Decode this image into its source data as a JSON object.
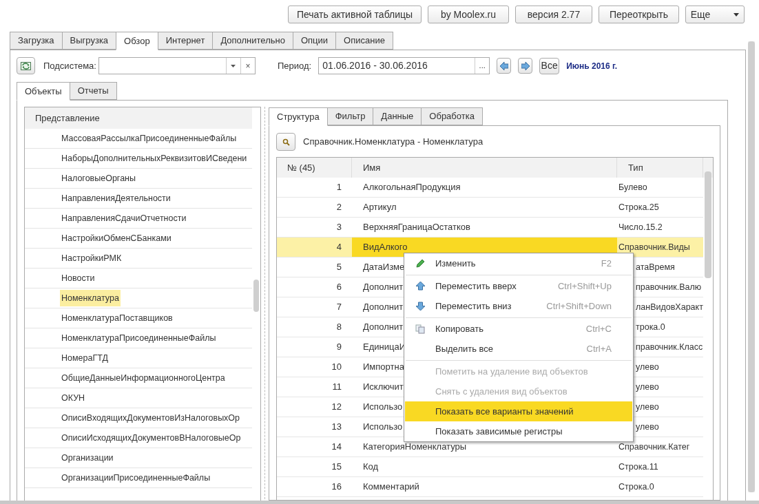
{
  "top_buttons": [
    {
      "label": "Печать активной таблицы",
      "kind": "plain"
    },
    {
      "label": "by Moolex.ru",
      "kind": "plain"
    },
    {
      "label": "версия 2.77",
      "kind": "plain"
    },
    {
      "label": "Переоткрыть",
      "kind": "plain"
    },
    {
      "label": "Еще",
      "kind": "dropdown"
    }
  ],
  "main_tabs": [
    {
      "label": "Загрузка",
      "selected": false
    },
    {
      "label": "Выгрузка",
      "selected": false
    },
    {
      "label": "Обзор",
      "selected": true
    },
    {
      "label": "Интернет",
      "selected": false
    },
    {
      "label": "Дополнительно",
      "selected": false
    },
    {
      "label": "Опции",
      "selected": false
    },
    {
      "label": "Описание",
      "selected": false
    }
  ],
  "filter_bar": {
    "subsystem_label": "Подсистема:",
    "period_label": "Период:",
    "period_value": "01.06.2016 - 30.06.2016",
    "ellipsis_button": "...",
    "clear_button": "×",
    "all_button": "Все",
    "period_title": "Июнь 2016 г."
  },
  "sub_tabs": [
    {
      "label": "Объекты",
      "selected": true
    },
    {
      "label": "Отчеты",
      "selected": false
    }
  ],
  "object_list": {
    "header": "Представление",
    "items": [
      {
        "label": "МассоваяРассылкаПрисоединенныеФайлы",
        "selected": false
      },
      {
        "label": "НаборыДополнительныхРеквизитовИСведени",
        "selected": false
      },
      {
        "label": "НалоговыеОрганы",
        "selected": false
      },
      {
        "label": "НаправленияДеятельности",
        "selected": false
      },
      {
        "label": "НаправленияСдачиОтчетности",
        "selected": false
      },
      {
        "label": "НастройкиОбменСБанками",
        "selected": false
      },
      {
        "label": "НастройкиРМК",
        "selected": false
      },
      {
        "label": "Новости",
        "selected": false
      },
      {
        "label": "Номенклатура",
        "selected": true
      },
      {
        "label": "НоменклатураПоставщиков",
        "selected": false
      },
      {
        "label": "НоменклатураПрисоединенныеФайлы",
        "selected": false
      },
      {
        "label": "НомераГТД",
        "selected": false
      },
      {
        "label": "ОбщиеДанныеИнформационногоЦентра",
        "selected": false
      },
      {
        "label": "ОКУН",
        "selected": false
      },
      {
        "label": "ОписиВходящихДокументовИзНалоговыхОр",
        "selected": false
      },
      {
        "label": "ОписиИсходящихДокументовВНалоговыеОр",
        "selected": false
      },
      {
        "label": "Организации",
        "selected": false
      },
      {
        "label": "ОрганизацииПрисоединенныеФайлы",
        "selected": false
      }
    ]
  },
  "detail_tabs": [
    {
      "label": "Структура",
      "selected": true
    },
    {
      "label": "Фильтр",
      "selected": false
    },
    {
      "label": "Данные",
      "selected": false
    },
    {
      "label": "Обработка",
      "selected": false
    }
  ],
  "object_title": "Справочник.Номенклатура - Номенклатура",
  "table": {
    "columns": [
      "№ (45)",
      "Имя",
      "Тип"
    ],
    "rows": [
      {
        "num": "1",
        "name": "АлкогольнаяПродукция",
        "type": "Булево",
        "selected": false
      },
      {
        "num": "2",
        "name": "Артикул",
        "type": "Строка.25",
        "selected": false
      },
      {
        "num": "3",
        "name": "ВерхняяГраницаОстатков",
        "type": "Число.15.2",
        "selected": false
      },
      {
        "num": "4",
        "name": "ВидАлкого",
        "type": "Справочник.Виды",
        "selected": true
      },
      {
        "num": "5",
        "name": "ДатаИзме",
        "type": "атаВремя",
        "selected": false
      },
      {
        "num": "6",
        "name": "Дополнит",
        "type": "правочник.Валю",
        "selected": false
      },
      {
        "num": "7",
        "name": "Дополнит",
        "type": "ланВидовХаракт",
        "selected": false
      },
      {
        "num": "8",
        "name": "Дополнит",
        "type": "трока.0",
        "selected": false
      },
      {
        "num": "9",
        "name": "ЕдиницаИ",
        "type": "правочник.Класс",
        "selected": false
      },
      {
        "num": "10",
        "name": "Импортна",
        "type": "улево",
        "selected": false
      },
      {
        "num": "11",
        "name": "Исключит",
        "type": "улево",
        "selected": false
      },
      {
        "num": "12",
        "name": "Использо",
        "type": "улево",
        "selected": false
      },
      {
        "num": "13",
        "name": "Использо",
        "type": "улево",
        "selected": false
      },
      {
        "num": "14",
        "name": "КатегорияНоменклатуры",
        "type": "Справочник.Катег",
        "selected": false
      },
      {
        "num": "15",
        "name": "Код",
        "type": "Строка.11",
        "selected": false
      },
      {
        "num": "16",
        "name": "Комментарий",
        "type": "Строка.0",
        "selected": false
      }
    ]
  },
  "context_menu": [
    {
      "kind": "item",
      "label": "Изменить",
      "shortcut": "F2",
      "disabled": false,
      "selected": false
    },
    {
      "kind": "separator"
    },
    {
      "kind": "item",
      "label": "Переместить вверх",
      "shortcut": "Ctrl+Shift+Up",
      "disabled": false,
      "selected": false
    },
    {
      "kind": "item",
      "label": "Переместить вниз",
      "shortcut": "Ctrl+Shift+Down",
      "disabled": false,
      "selected": false
    },
    {
      "kind": "separator"
    },
    {
      "kind": "item",
      "label": "Копировать",
      "shortcut": "Ctrl+C",
      "disabled": false,
      "selected": false
    },
    {
      "kind": "item",
      "label": "Выделить все",
      "shortcut": "Ctrl+A",
      "disabled": false,
      "selected": false
    },
    {
      "kind": "separator"
    },
    {
      "kind": "item",
      "label": "Пометить на удаление вид объектов",
      "disabled": true,
      "selected": false
    },
    {
      "kind": "item",
      "label": "Снять с удаления вид объектов",
      "disabled": true,
      "selected": false
    },
    {
      "kind": "item",
      "label": "Показать все варианты значений",
      "disabled": false,
      "selected": true
    },
    {
      "kind": "item",
      "label": "Показать зависимые регистры",
      "disabled": false,
      "selected": false
    }
  ]
}
